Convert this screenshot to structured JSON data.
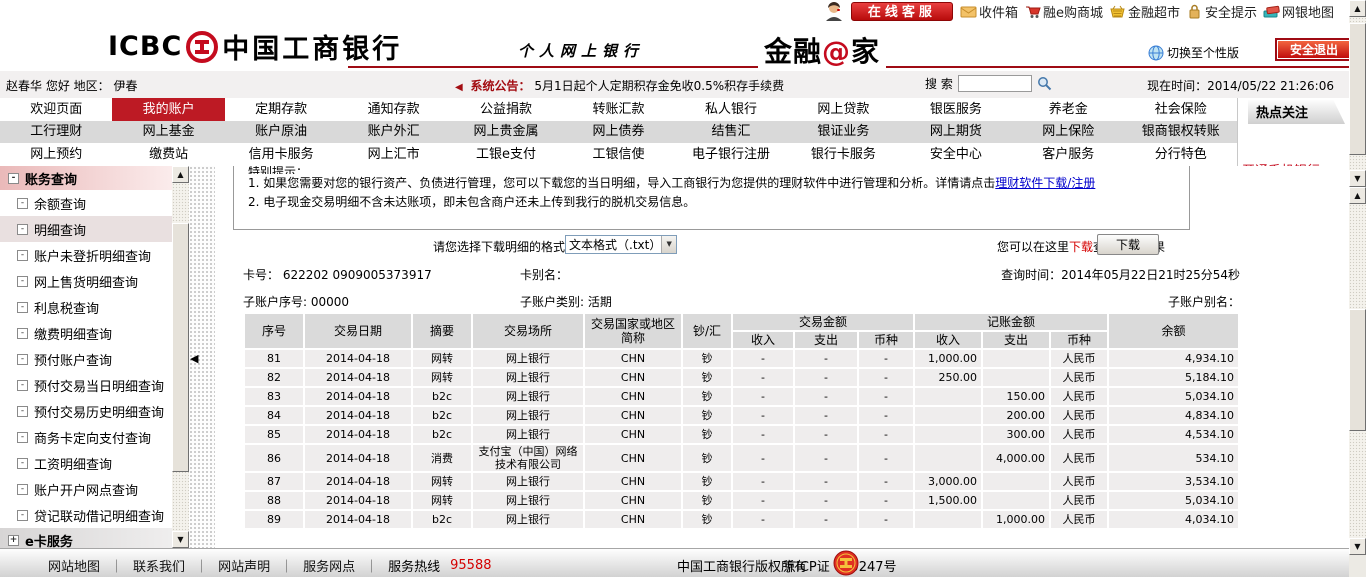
{
  "colors": {
    "icbc_red": "#c40b1e",
    "nav_active_bg": "#bd1a24",
    "dark_red": "#9f0b14",
    "link_blue": "#0000cc",
    "red_text": "#d40000",
    "table_header_bg": "#dadada",
    "table_cell_bg": "#efeded"
  },
  "utility": {
    "customer_service": "在线客服",
    "links": [
      {
        "icon": "inbox-icon",
        "label": "收件箱"
      },
      {
        "icon": "mall-icon",
        "label": "融e购商城"
      },
      {
        "icon": "market-icon",
        "label": "金融超市"
      },
      {
        "icon": "security-icon",
        "label": "安全提示"
      },
      {
        "icon": "map-icon",
        "label": "网银地图"
      }
    ]
  },
  "header": {
    "logo_en": "ICBC",
    "logo_cn": "中国工商银行",
    "subtitle": "个人网上银行",
    "brand": {
      "pre": "金融",
      "at": "@",
      "post": "家"
    },
    "switch_label": "切换至个性版",
    "logout_label": "安全退出"
  },
  "announce": {
    "greeting": "赵春华 您好 地区： 伊春",
    "horn": "◀",
    "bulletin_label": "系统公告：",
    "bulletin_text": "5月1日起个人定期积存金免收0.5%积存手续费",
    "search_label": "搜 索",
    "search_value": "",
    "time_label": "现在时间：",
    "time": "2014/05/22 21:26:06"
  },
  "nav": {
    "active": "我的账户",
    "rows": [
      [
        "欢迎页面",
        "我的账户",
        "定期存款",
        "通知存款",
        "公益捐款",
        "转账汇款",
        "私人银行",
        "网上贷款",
        "银医服务",
        "养老金",
        "社会保险"
      ],
      [
        "工行理财",
        "网上基金",
        "账户原油",
        "账户外汇",
        "网上贵金属",
        "网上债券",
        "结售汇",
        "银证业务",
        "网上期货",
        "网上保险",
        "银商银权转账"
      ],
      [
        "网上预约",
        "缴费站",
        "信用卡服务",
        "网上汇市",
        "工银e支付",
        "工银信使",
        "电子银行注册",
        "银行卡服务",
        "安全中心",
        "客户服务",
        "分行特色"
      ]
    ],
    "hot_title": "热点关注",
    "hot_link": "开通手机银行"
  },
  "sidebar": {
    "items": [
      {
        "label": "账务查询",
        "type": "sec",
        "mark": "-"
      },
      {
        "label": "余额查询",
        "type": "child",
        "mark": "-"
      },
      {
        "label": "明细查询",
        "type": "child",
        "mark": "-",
        "active": true
      },
      {
        "label": "账户未登折明细查询",
        "type": "child",
        "mark": "-"
      },
      {
        "label": "网上售货明细查询",
        "type": "child",
        "mark": "-"
      },
      {
        "label": "利息税查询",
        "type": "child",
        "mark": "-"
      },
      {
        "label": "缴费明细查询",
        "type": "child",
        "mark": "-"
      },
      {
        "label": "预付账户查询",
        "type": "child",
        "mark": "-"
      },
      {
        "label": "预付交易当日明细查询",
        "type": "child",
        "mark": "-"
      },
      {
        "label": "预付交易历史明细查询",
        "type": "child",
        "mark": "-"
      },
      {
        "label": "商务卡定向支付查询",
        "type": "child",
        "mark": "-"
      },
      {
        "label": "工资明细查询",
        "type": "child",
        "mark": "-"
      },
      {
        "label": "账户开户网点查询",
        "type": "child",
        "mark": "-"
      },
      {
        "label": "贷记联动借记明细查询",
        "type": "child",
        "mark": "-"
      },
      {
        "label": "e卡服务",
        "type": "sec2",
        "mark": "+"
      }
    ]
  },
  "content": {
    "notice_title": "特别提示：",
    "note1": "1. 如果您需要对您的银行资产、负债进行管理，您可以下载您的当日明细，导入工商银行为您提供的理财软件中进行管理和分析。详情请点击",
    "note1_link": "理财软件下载/注册",
    "note2": "2. 电子现金交易明细不含未达账项，即未包含商户还未上传到我行的脱机交易信息。",
    "format_label": "请您选择下载明细的格式",
    "format_value": "文本格式（.txt）",
    "hint_pre": "您可以在这里",
    "hint_red": "下载",
    "hint_post": "查询明细结果",
    "download_btn": "下载",
    "card_no_label": "卡号：",
    "card_no": "622202 0909005373917",
    "card_alias_label": "卡别名：",
    "query_time_label": "查询时间：",
    "query_time": "2014年05月22日21时25分54秒",
    "sub_seq_label": "子账户序号:",
    "sub_seq": "00000",
    "sub_type_label": "子账户类别:",
    "sub_type": "活期",
    "sub_alias_label": "子账户别名："
  },
  "table": {
    "header": {
      "seq": "序号",
      "date": "交易日期",
      "summary": "摘要",
      "place": "交易场所",
      "country": "交易国家或地区简称",
      "cash": "钞/汇",
      "txn_group": "交易金额",
      "book_group": "记账金额",
      "income": "收入",
      "expense": "支出",
      "currency": "币种",
      "balance": "余额"
    },
    "column_keys": [
      "seq",
      "date",
      "summary",
      "place",
      "country",
      "cash",
      "t_in",
      "t_out",
      "t_cur",
      "b_in",
      "b_out",
      "b_cur",
      "balance"
    ],
    "rows": [
      {
        "seq": "81",
        "date": "2014-04-18",
        "summary": "网转",
        "place": "网上银行",
        "country": "CHN",
        "cash": "钞",
        "t_in": "-",
        "t_out": "-",
        "t_cur": "-",
        "b_in": "1,000.00",
        "b_out": "",
        "b_cur": "人民币",
        "balance": "4,934.10"
      },
      {
        "seq": "82",
        "date": "2014-04-18",
        "summary": "网转",
        "place": "网上银行",
        "country": "CHN",
        "cash": "钞",
        "t_in": "-",
        "t_out": "-",
        "t_cur": "-",
        "b_in": "250.00",
        "b_out": "",
        "b_cur": "人民币",
        "balance": "5,184.10"
      },
      {
        "seq": "83",
        "date": "2014-04-18",
        "summary": "b2c",
        "place": "网上银行",
        "country": "CHN",
        "cash": "钞",
        "t_in": "-",
        "t_out": "-",
        "t_cur": "-",
        "b_in": "",
        "b_out": "150.00",
        "b_cur": "人民币",
        "balance": "5,034.10"
      },
      {
        "seq": "84",
        "date": "2014-04-18",
        "summary": "b2c",
        "place": "网上银行",
        "country": "CHN",
        "cash": "钞",
        "t_in": "-",
        "t_out": "-",
        "t_cur": "-",
        "b_in": "",
        "b_out": "200.00",
        "b_cur": "人民币",
        "balance": "4,834.10"
      },
      {
        "seq": "85",
        "date": "2014-04-18",
        "summary": "b2c",
        "place": "网上银行",
        "country": "CHN",
        "cash": "钞",
        "t_in": "-",
        "t_out": "-",
        "t_cur": "-",
        "b_in": "",
        "b_out": "300.00",
        "b_cur": "人民币",
        "balance": "4,534.10"
      },
      {
        "seq": "86",
        "date": "2014-04-18",
        "summary": "消费",
        "place": "支付宝（中国）网络技术有限公司",
        "country": "CHN",
        "cash": "钞",
        "t_in": "-",
        "t_out": "-",
        "t_cur": "-",
        "b_in": "",
        "b_out": "4,000.00",
        "b_cur": "人民币",
        "balance": "534.10"
      },
      {
        "seq": "87",
        "date": "2014-04-18",
        "summary": "网转",
        "place": "网上银行",
        "country": "CHN",
        "cash": "钞",
        "t_in": "-",
        "t_out": "-",
        "t_cur": "-",
        "b_in": "3,000.00",
        "b_out": "",
        "b_cur": "人民币",
        "balance": "3,534.10"
      },
      {
        "seq": "88",
        "date": "2014-04-18",
        "summary": "网转",
        "place": "网上银行",
        "country": "CHN",
        "cash": "钞",
        "t_in": "-",
        "t_out": "-",
        "t_cur": "-",
        "b_in": "1,500.00",
        "b_out": "",
        "b_cur": "人民币",
        "balance": "5,034.10"
      },
      {
        "seq": "89",
        "date": "2014-04-18",
        "summary": "b2c",
        "place": "网上银行",
        "country": "CHN",
        "cash": "钞",
        "t_in": "-",
        "t_out": "-",
        "t_cur": "-",
        "b_in": "",
        "b_out": "1,000.00",
        "b_cur": "人民币",
        "balance": "4,034.10"
      }
    ]
  },
  "footer": {
    "links": [
      "网站地图",
      "联系我们",
      "网站声明",
      "服务网点"
    ],
    "hotline_label": "服务热线",
    "hotline": "95588",
    "copyright": "中国工商银行版权所有",
    "icp": "京ICP证 030247号"
  }
}
